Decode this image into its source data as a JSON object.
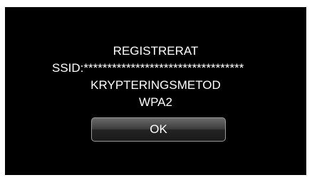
{
  "dialog": {
    "status": "REGISTRERAT",
    "ssid": "SSID:**********************************",
    "encryption_label": "KRYPTERINGSMETOD",
    "encryption_value": "WPA2",
    "ok_label": "OK"
  },
  "colors": {
    "background": "#000000",
    "text": "#ffffff",
    "button_border": "#9a9a9a"
  }
}
